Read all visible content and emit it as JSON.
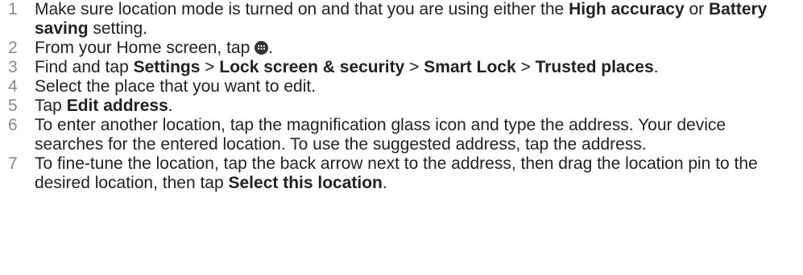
{
  "steps": [
    {
      "number": "1",
      "parts": [
        "Make sure location mode is turned on and that you are using either the ",
        "High accuracy",
        " or ",
        "Battery saving",
        " setting."
      ]
    },
    {
      "number": "2",
      "parts": [
        "From your Home screen, tap ",
        "."
      ],
      "icon": "apps-grid-icon"
    },
    {
      "number": "3",
      "parts": [
        "Find and tap ",
        "Settings",
        " > ",
        "Lock screen & security",
        " > ",
        "Smart Lock",
        " > ",
        "Trusted places",
        "."
      ]
    },
    {
      "number": "4",
      "parts": [
        "Select the place that you want to edit."
      ]
    },
    {
      "number": "5",
      "parts": [
        "Tap ",
        "Edit address",
        "."
      ]
    },
    {
      "number": "6",
      "parts": [
        "To enter another location, tap the magnification glass icon and type the address. Your device searches for the entered location. To use the suggested address, tap the address."
      ]
    },
    {
      "number": "7",
      "parts": [
        "To fine-tune the location, tap the back arrow next to the address, then drag the location pin to the desired location, then tap ",
        "Select this location",
        "."
      ]
    }
  ]
}
